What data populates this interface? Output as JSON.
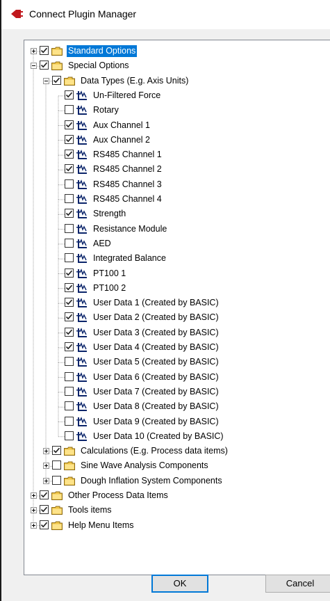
{
  "window": {
    "title": "Connect Plugin Manager"
  },
  "tree": [
    {
      "label": "Standard Options",
      "depth": 0,
      "checked": true,
      "icon": "folder-icon",
      "expander": "plus",
      "selected": true
    },
    {
      "label": "Special Options",
      "depth": 0,
      "checked": true,
      "icon": "folder-icon",
      "expander": "minus"
    },
    {
      "label": "Data Types (E.g. Axis Units)",
      "depth": 1,
      "checked": true,
      "icon": "folder-icon",
      "expander": "minus"
    },
    {
      "label": "Un-Filtered Force",
      "depth": 2,
      "checked": true,
      "icon": "data-type-icon"
    },
    {
      "label": "Rotary",
      "depth": 2,
      "checked": false,
      "icon": "data-type-icon"
    },
    {
      "label": "Aux Channel 1",
      "depth": 2,
      "checked": true,
      "icon": "data-type-icon"
    },
    {
      "label": "Aux Channel 2",
      "depth": 2,
      "checked": true,
      "icon": "data-type-icon"
    },
    {
      "label": "RS485 Channel 1",
      "depth": 2,
      "checked": true,
      "icon": "data-type-icon"
    },
    {
      "label": "RS485 Channel 2",
      "depth": 2,
      "checked": true,
      "icon": "data-type-icon"
    },
    {
      "label": "RS485 Channel 3",
      "depth": 2,
      "checked": false,
      "icon": "data-type-icon"
    },
    {
      "label": "RS485 Channel 4",
      "depth": 2,
      "checked": false,
      "icon": "data-type-icon"
    },
    {
      "label": "Strength",
      "depth": 2,
      "checked": true,
      "icon": "data-type-icon"
    },
    {
      "label": "Resistance Module",
      "depth": 2,
      "checked": false,
      "icon": "data-type-icon"
    },
    {
      "label": "AED",
      "depth": 2,
      "checked": false,
      "icon": "data-type-icon"
    },
    {
      "label": "Integrated Balance",
      "depth": 2,
      "checked": false,
      "icon": "data-type-icon"
    },
    {
      "label": "PT100 1",
      "depth": 2,
      "checked": true,
      "icon": "data-type-icon"
    },
    {
      "label": "PT100 2",
      "depth": 2,
      "checked": true,
      "icon": "data-type-icon"
    },
    {
      "label": "User Data 1 (Created by BASIC)",
      "depth": 2,
      "checked": true,
      "icon": "data-type-icon"
    },
    {
      "label": "User Data 2 (Created by BASIC)",
      "depth": 2,
      "checked": true,
      "icon": "data-type-icon"
    },
    {
      "label": "User Data 3 (Created by BASIC)",
      "depth": 2,
      "checked": true,
      "icon": "data-type-icon"
    },
    {
      "label": "User Data 4 (Created by BASIC)",
      "depth": 2,
      "checked": true,
      "icon": "data-type-icon"
    },
    {
      "label": "User Data 5 (Created by BASIC)",
      "depth": 2,
      "checked": false,
      "icon": "data-type-icon"
    },
    {
      "label": "User Data 6 (Created by BASIC)",
      "depth": 2,
      "checked": false,
      "icon": "data-type-icon"
    },
    {
      "label": "User Data 7 (Created by BASIC)",
      "depth": 2,
      "checked": false,
      "icon": "data-type-icon"
    },
    {
      "label": "User Data 8 (Created by BASIC)",
      "depth": 2,
      "checked": false,
      "icon": "data-type-icon"
    },
    {
      "label": "User Data 9 (Created by BASIC)",
      "depth": 2,
      "checked": false,
      "icon": "data-type-icon"
    },
    {
      "label": "User Data 10 (Created by BASIC)",
      "depth": 2,
      "checked": false,
      "icon": "data-type-icon"
    },
    {
      "label": "Calculations (E.g. Process data items)",
      "depth": 1,
      "checked": true,
      "icon": "folder-icon",
      "expander": "plus"
    },
    {
      "label": "Sine Wave Analysis Components",
      "depth": 1,
      "checked": false,
      "icon": "folder-icon",
      "expander": "plus"
    },
    {
      "label": "Dough Inflation System Components",
      "depth": 1,
      "checked": false,
      "icon": "folder-icon",
      "expander": "plus"
    },
    {
      "label": "Other Process Data Items",
      "depth": 0,
      "checked": true,
      "icon": "folder-icon",
      "expander": "plus"
    },
    {
      "label": "Tools items",
      "depth": 0,
      "checked": true,
      "icon": "folder-icon",
      "expander": "plus"
    },
    {
      "label": "Help Menu Items",
      "depth": 0,
      "checked": true,
      "icon": "folder-icon",
      "expander": "plus"
    }
  ],
  "buttons": {
    "ok": "OK",
    "cancel": "Cancel"
  },
  "colors": {
    "selection": "#0078d7",
    "folder": "#f0c649",
    "checkmark": "#212121",
    "data_icon": "#0a246a"
  }
}
